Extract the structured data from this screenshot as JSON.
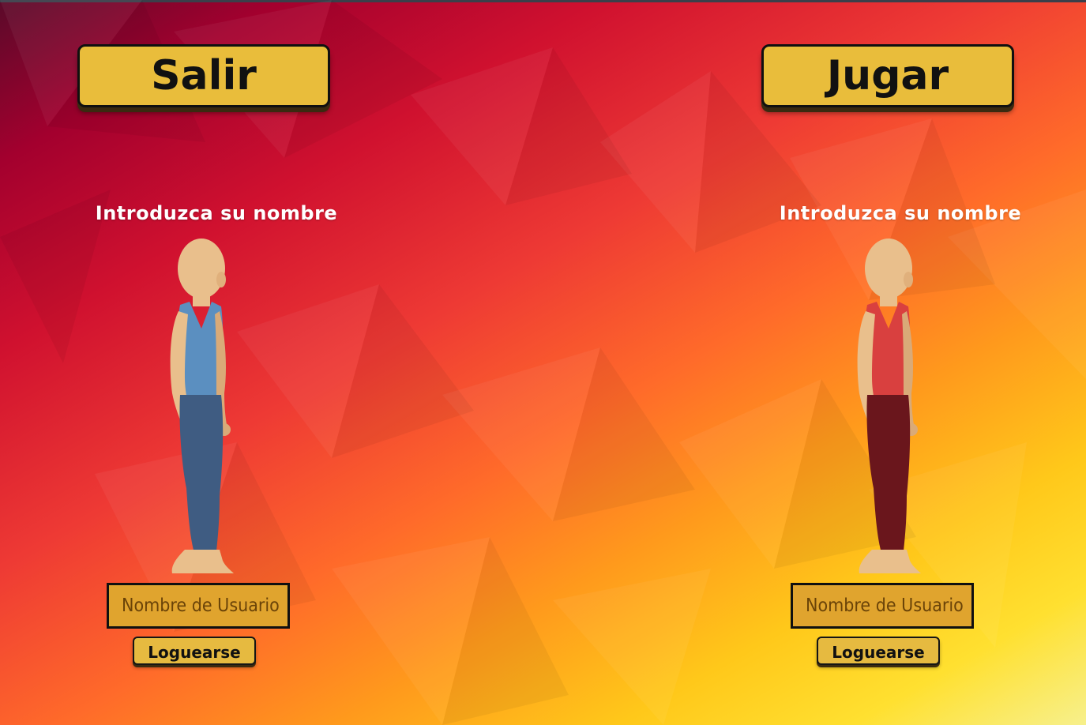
{
  "header": {
    "exit_label": "Salir",
    "play_label": "Jugar"
  },
  "players": [
    {
      "prompt": "Introduzca su nombre",
      "input_placeholder": "Nombre de Usuario",
      "login_label": "Loguearse",
      "shirt_color": "#5b8fc0",
      "pants_color": "#3f5c82"
    },
    {
      "prompt": "Introduzca su nombre",
      "input_placeholder": "Nombre de Usuario",
      "login_label": "Loguearse",
      "shirt_color": "#d9403f",
      "pants_color": "#6a161c"
    }
  ],
  "theme": {
    "button_color": "#e9bd3b",
    "input_color": "#e0a42e",
    "skin_color": "#e9bf8c"
  }
}
